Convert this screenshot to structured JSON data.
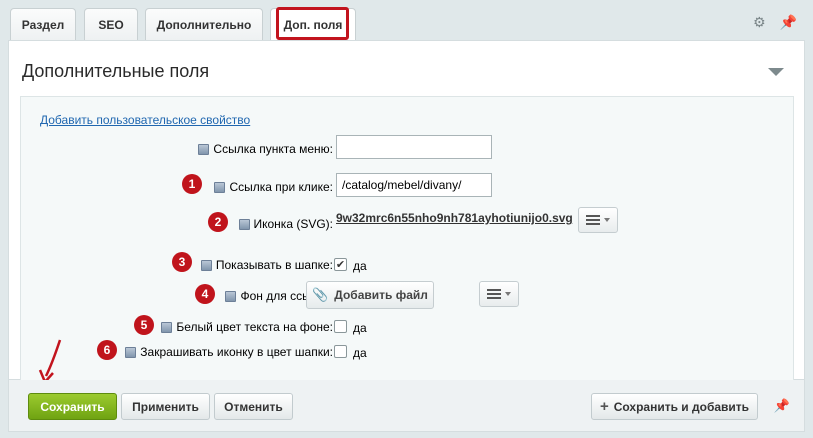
{
  "tabs": [
    {
      "label": "Раздел"
    },
    {
      "label": "SEO"
    },
    {
      "label": "Дополнительно"
    },
    {
      "label": "Доп. поля"
    }
  ],
  "tab_tools": {
    "settings_icon": "gear-icon",
    "pin_icon": "pin-icon"
  },
  "section": {
    "title": "Дополнительные поля",
    "add_property_link": "Добавить пользовательское свойство"
  },
  "fields": {
    "menu_link": {
      "label": "Ссылка пункта меню:",
      "value": ""
    },
    "click_link": {
      "badge": "1",
      "label": "Ссылка при клике:",
      "value": "/catalog/mebel/divany/"
    },
    "icon_svg": {
      "badge": "2",
      "label": "Иконка (SVG):",
      "file_name": "9w32mrc6n55nho9nh781ayhotiunijo0.svg"
    },
    "show_in_header": {
      "badge": "3",
      "label": "Показывать в шапке:",
      "checked": true,
      "option_label": "да"
    },
    "link_background": {
      "badge": "4",
      "label": "Фон для ссылки:",
      "button_label": "Добавить файл"
    },
    "white_text": {
      "badge": "5",
      "label": "Белый цвет текста на фоне:",
      "checked": false,
      "option_label": "да"
    },
    "color_icon": {
      "badge": "6",
      "label": "Закрашивать иконку в цвет шапки:",
      "checked": false,
      "option_label": "да"
    }
  },
  "footer": {
    "save": "Сохранить",
    "apply": "Применить",
    "cancel": "Отменить",
    "save_and_add": "Сохранить и добавить"
  },
  "colors": {
    "accent_green": "#7ab317",
    "highlight_red": "#c2141e",
    "link_blue": "#2067b0"
  }
}
